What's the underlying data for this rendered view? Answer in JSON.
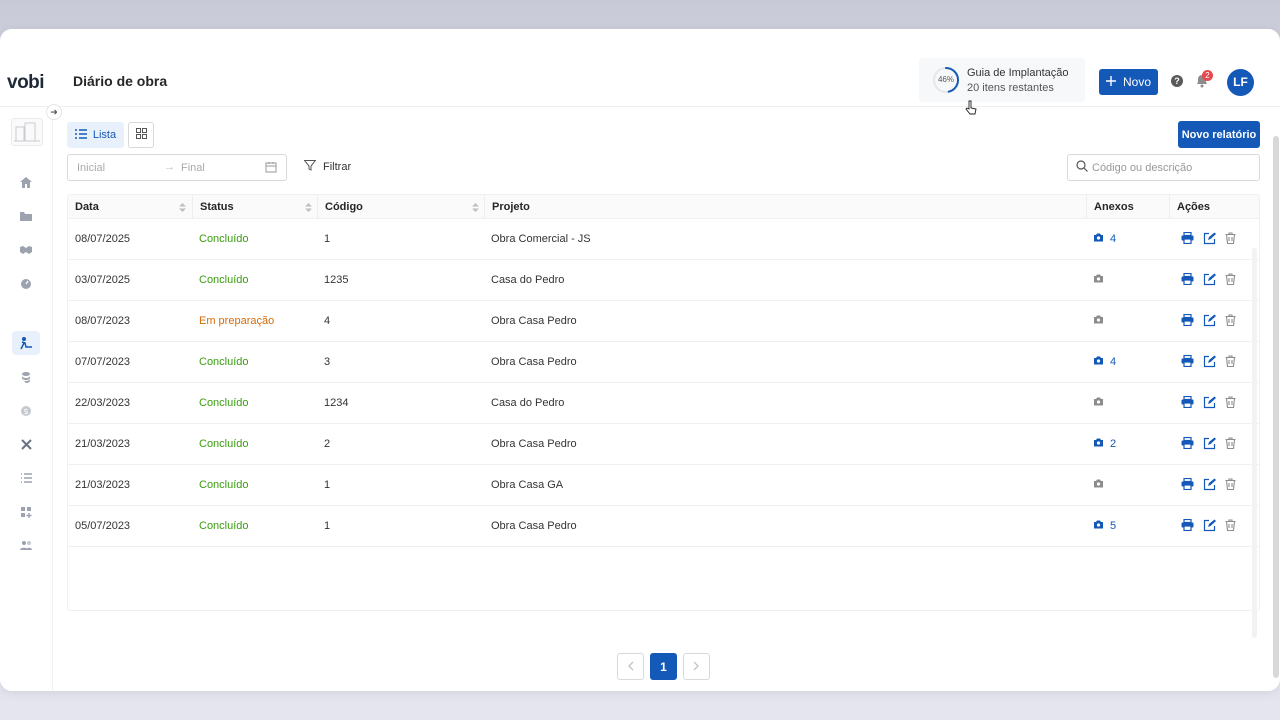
{
  "app": {
    "logo": "vobi",
    "page_title": "Diário de obra"
  },
  "guide": {
    "percent": "46%",
    "progress": 0.46,
    "title": "Guia de Implantação",
    "subtitle": "20 itens restantes"
  },
  "header": {
    "new_button": "Novo",
    "help_icon": "question-circle-icon",
    "notifications_count": "2",
    "avatar_initials": "LF"
  },
  "sidebar": {
    "items": [
      {
        "icon": "home-icon"
      },
      {
        "icon": "folder-icon"
      },
      {
        "icon": "handshake-icon"
      },
      {
        "icon": "gauge-icon"
      },
      {
        "icon": "construction-worker-icon",
        "active": true
      },
      {
        "icon": "coins-icon"
      },
      {
        "icon": "dollar-icon"
      },
      {
        "icon": "tools-icon"
      },
      {
        "icon": "list-icon"
      },
      {
        "icon": "apps-add-icon"
      },
      {
        "icon": "users-icon"
      }
    ]
  },
  "toolbar": {
    "view_list_label": "Lista",
    "new_report_button": "Novo relatório",
    "date_start_placeholder": "Inicial",
    "date_end_placeholder": "Final",
    "filter_label": "Filtrar",
    "search_placeholder": "Código ou descrição"
  },
  "table": {
    "columns": {
      "date": "Data",
      "status": "Status",
      "code": "Código",
      "project": "Projeto",
      "attachments": "Anexos",
      "actions": "Ações"
    },
    "rows": [
      {
        "date": "08/07/2025",
        "status": "Concluído",
        "status_kind": "done",
        "code": "1",
        "project": "Obra Comercial - JS",
        "attachments": "4"
      },
      {
        "date": "03/07/2025",
        "status": "Concluído",
        "status_kind": "done",
        "code": "1235",
        "project": "Casa do Pedro",
        "attachments": ""
      },
      {
        "date": "08/07/2023",
        "status": "Em preparação",
        "status_kind": "prep",
        "code": "4",
        "project": "Obra Casa Pedro",
        "attachments": ""
      },
      {
        "date": "07/07/2023",
        "status": "Concluído",
        "status_kind": "done",
        "code": "3",
        "project": "Obra Casa Pedro",
        "attachments": "4"
      },
      {
        "date": "22/03/2023",
        "status": "Concluído",
        "status_kind": "done",
        "code": "1234",
        "project": "Casa do Pedro",
        "attachments": ""
      },
      {
        "date": "21/03/2023",
        "status": "Concluído",
        "status_kind": "done",
        "code": "2",
        "project": "Obra Casa Pedro",
        "attachments": "2"
      },
      {
        "date": "21/03/2023",
        "status": "Concluído",
        "status_kind": "done",
        "code": "1",
        "project": "Obra Casa GA",
        "attachments": ""
      },
      {
        "date": "05/07/2023",
        "status": "Concluído",
        "status_kind": "done",
        "code": "1",
        "project": "Obra Casa Pedro",
        "attachments": "5"
      }
    ]
  },
  "pagination": {
    "current": "1"
  },
  "colors": {
    "primary": "#1458b8",
    "done": "#389e0d",
    "prep": "#d46b08",
    "badge": "#e5484d"
  }
}
